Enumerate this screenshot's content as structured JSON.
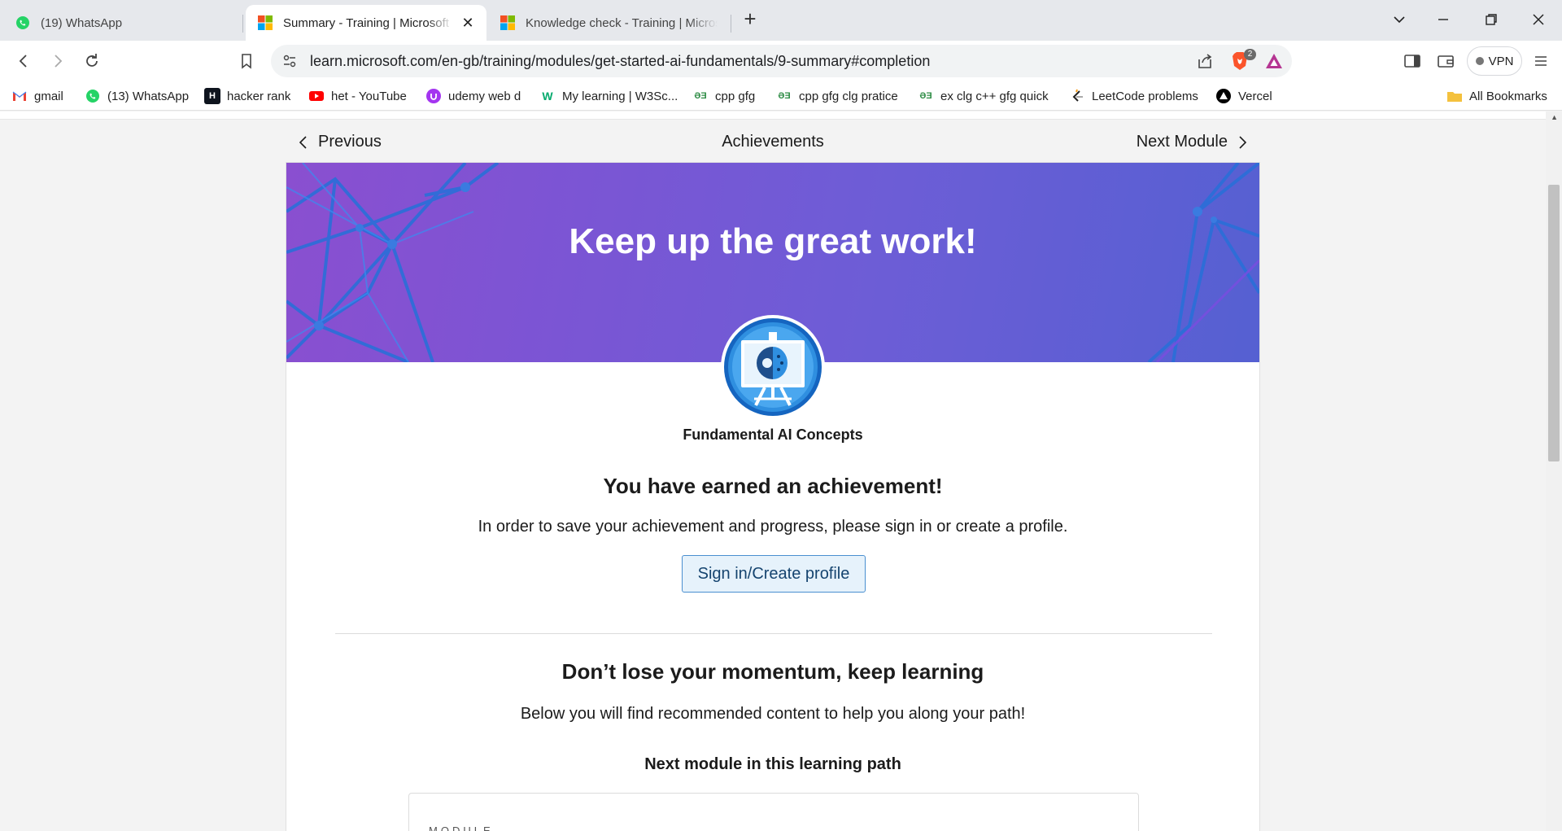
{
  "browser": {
    "tabs": [
      {
        "label": "(19) WhatsApp",
        "active": false
      },
      {
        "label": "Summary - Training | Microsoft Learn",
        "active": true
      },
      {
        "label": "Knowledge check - Training | Microsoft Learn",
        "active": false
      }
    ],
    "url": "learn.microsoft.com/en-gb/training/modules/get-started-ai-fundamentals/9-summary#completion",
    "shields_count": "2",
    "vpn_label": "VPN",
    "bookmarks": [
      {
        "label": "gmail",
        "icon": "gmail-icon"
      },
      {
        "label": "(13) WhatsApp",
        "icon": "whatsapp-icon"
      },
      {
        "label": "hacker rank",
        "icon": "hackerrank-icon"
      },
      {
        "label": "het - YouTube",
        "icon": "youtube-icon"
      },
      {
        "label": "udemy web d",
        "icon": "udemy-icon"
      },
      {
        "label": "My learning | W3Sc...",
        "icon": "w3schools-icon"
      },
      {
        "label": "cpp gfg",
        "icon": "gfg-icon"
      },
      {
        "label": "cpp gfg clg pratice",
        "icon": "gfg-icon"
      },
      {
        "label": "ex clg c++ gfg quick",
        "icon": "gfg-icon"
      },
      {
        "label": "LeetCode problems",
        "icon": "leetcode-icon"
      },
      {
        "label": "Vercel",
        "icon": "vercel-icon"
      }
    ],
    "all_bookmarks_label": "All Bookmarks"
  },
  "module_nav": {
    "previous": "Previous",
    "title": "Achievements",
    "next": "Next Module"
  },
  "achievement": {
    "hero_title": "Keep up the great work!",
    "name": "Fundamental AI Concepts",
    "earned": "You have earned an achievement!",
    "save_message": "In order to save your achievement and progress, please sign in or create a profile.",
    "signin_button": "Sign in/Create profile"
  },
  "recommendations": {
    "heading": "Don’t lose your momentum, keep learning",
    "subtext": "Below you will find recommended content to help you along your path!",
    "next_module_heading": "Next module in this learning path",
    "card_type": "MODULE"
  },
  "colors": {
    "hero_gradient_start": "#8a4fd0",
    "hero_gradient_end": "#5560d2",
    "button_bg": "#e6f2fb",
    "button_border": "#4a8fd0"
  }
}
